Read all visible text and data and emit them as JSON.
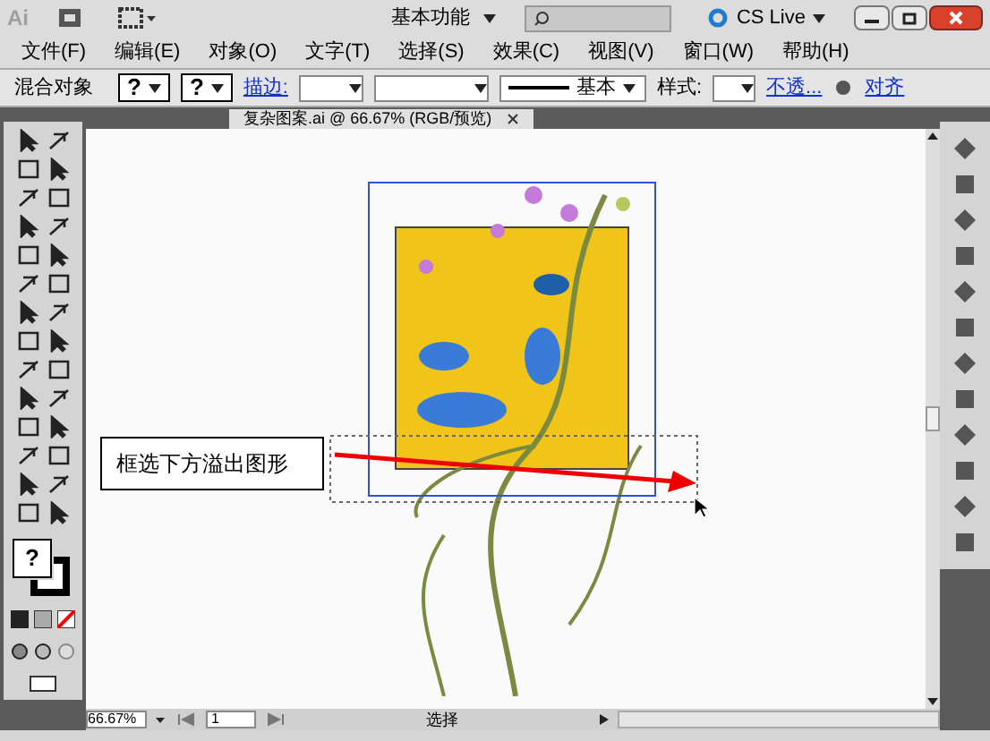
{
  "app": {
    "logo": "Ai",
    "workspace": "基本功能",
    "cs_live": "CS Live"
  },
  "menu": [
    "文件(F)",
    "编辑(E)",
    "对象(O)",
    "文字(T)",
    "选择(S)",
    "效果(C)",
    "视图(V)",
    "窗口(W)",
    "帮助(H)"
  ],
  "control_bar": {
    "object_type": "混合对象",
    "fill": "?",
    "stroke": "?",
    "stroke_label": "描边:",
    "stroke_profile": "基本",
    "style_label": "样式:",
    "opacity_link": "不透...",
    "align_link": "对齐"
  },
  "document_tab": {
    "title": "复杂图案.ai @ 66.67% (RGB/预览)"
  },
  "callout": {
    "text": "框选下方溢出图形"
  },
  "status_bar": {
    "zoom": "66.67%",
    "artboard": "1",
    "tool": "选择"
  }
}
